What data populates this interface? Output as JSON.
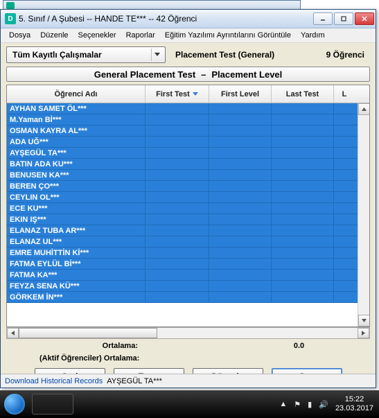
{
  "bg_window": {
    "title_fragment": ""
  },
  "window": {
    "title": "5. Sınıf / A Şubesi -- HANDE TE*** -- 42 Öğrenci"
  },
  "menu": {
    "items": [
      "Dosya",
      "Düzenle",
      "Seçenekler",
      "Raporlar",
      "Eğitim Yazılımı Ayrıntılarını Görüntüle",
      "Yardım"
    ]
  },
  "toolbar": {
    "combo_label": "Tüm Kayıtlı Çalışmalar",
    "test_label": "Placement Test (General)",
    "count_label": "9 Öğrenci"
  },
  "banner": {
    "left": "General Placement Test",
    "sep": "–",
    "right": "Placement Level"
  },
  "grid": {
    "headers": {
      "name": "Öğrenci Adı",
      "first_test": "First Test",
      "first_level": "First Level",
      "last_test": "Last Test",
      "last_partial": "L"
    },
    "rows": [
      "AYHAN SAMET ÖL***",
      "M.Yaman Bİ***",
      "OSMAN KAYRA AL***",
      "ADA UĞ***",
      "AYŞEGÜL TA***",
      "BATIN ADA KU***",
      "BENUSEN KA***",
      "BEREN ÇO***",
      "CEYLIN OL***",
      "ECE KU***",
      "EKIN IŞ***",
      "ELANAZ TUBA AR***",
      "ELANAZ UL***",
      "EMRE MUHİTTİN Kİ***",
      "FATMA EYLÜL Bİ***",
      "FATMA KA***",
      "FEYZA SENA KÜ***",
      "GÖRKEM İN***"
    ]
  },
  "summary": {
    "avg_label": "Ortalama:",
    "avg_value": "0.0",
    "active_label": "(Aktif Öğrenciler) Ortalama:"
  },
  "buttons": {
    "back": "Geri",
    "tutor": "Tutor",
    "edit": "Düzenle",
    "select": "Seç"
  },
  "status": {
    "link": "Download Historical Records",
    "student": "AYŞEGÜL TA***"
  },
  "taskbar": {
    "time": "15:22",
    "date": "23.03.2017"
  }
}
